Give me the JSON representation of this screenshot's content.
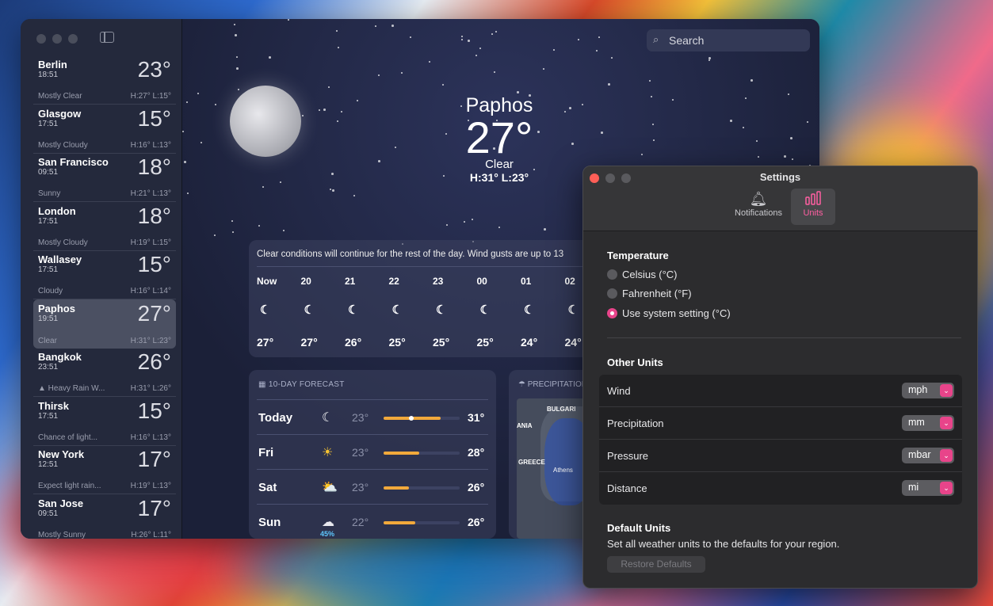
{
  "search": {
    "placeholder": "Search"
  },
  "sidebar": {
    "cities": [
      {
        "name": "Berlin",
        "time": "18:51",
        "temp": "23°",
        "condition": "Mostly Clear",
        "hilo": "H:27° L:15°"
      },
      {
        "name": "Glasgow",
        "time": "17:51",
        "temp": "15°",
        "condition": "Mostly Cloudy",
        "hilo": "H:16° L:13°"
      },
      {
        "name": "San Francisco",
        "time": "09:51",
        "temp": "18°",
        "condition": "Sunny",
        "hilo": "H:21° L:13°"
      },
      {
        "name": "London",
        "time": "17:51",
        "temp": "18°",
        "condition": "Mostly Cloudy",
        "hilo": "H:19° L:15°"
      },
      {
        "name": "Wallasey",
        "time": "17:51",
        "temp": "15°",
        "condition": "Cloudy",
        "hilo": "H:16° L:14°"
      },
      {
        "name": "Paphos",
        "time": "19:51",
        "temp": "27°",
        "condition": "Clear",
        "hilo": "H:31° L:23°"
      },
      {
        "name": "Bangkok",
        "time": "23:51",
        "temp": "26°",
        "condition": "▲ Heavy Rain W...",
        "hilo": "H:31° L:26°"
      },
      {
        "name": "Thirsk",
        "time": "17:51",
        "temp": "15°",
        "condition": "Chance of light...",
        "hilo": "H:16° L:13°"
      },
      {
        "name": "New York",
        "time": "12:51",
        "temp": "17°",
        "condition": "Expect light rain...",
        "hilo": "H:19° L:13°"
      },
      {
        "name": "San Jose",
        "time": "09:51",
        "temp": "17°",
        "condition": "Mostly Sunny",
        "hilo": "H:26° L:11°"
      }
    ]
  },
  "hero": {
    "place": "Paphos",
    "temp": "27°",
    "condition": "Clear",
    "hilo": "H:31°  L:23°"
  },
  "hourly": {
    "summary": "Clear conditions will continue for the rest of the day. Wind gusts are up to 13",
    "hours": [
      {
        "time": "Now",
        "icon": "moon-star-icon",
        "glyph": "☾",
        "temp": "27°"
      },
      {
        "time": "20",
        "icon": "moon-star-icon",
        "glyph": "☾",
        "temp": "27°"
      },
      {
        "time": "21",
        "icon": "moon-star-icon",
        "glyph": "☾",
        "temp": "26°"
      },
      {
        "time": "22",
        "icon": "moon-star-icon",
        "glyph": "☾",
        "temp": "25°"
      },
      {
        "time": "23",
        "icon": "moon-star-icon",
        "glyph": "☾",
        "temp": "25°"
      },
      {
        "time": "00",
        "icon": "moon-star-icon",
        "glyph": "☾",
        "temp": "25°"
      },
      {
        "time": "01",
        "icon": "moon-star-icon",
        "glyph": "☾",
        "temp": "24°"
      },
      {
        "time": "02",
        "icon": "moon-star-icon",
        "glyph": "☾",
        "temp": "24°"
      }
    ]
  },
  "tenday": {
    "header": "10-DAY FORECAST",
    "days": [
      {
        "day": "Today",
        "icon": "moon-star-icon",
        "glyph": "☾",
        "low": "23°",
        "high": "31°"
      },
      {
        "day": "Fri",
        "icon": "sun-icon",
        "glyph": "☀",
        "low": "23°",
        "high": "28°"
      },
      {
        "day": "Sat",
        "icon": "partly-cloudy-icon",
        "glyph": "⛅",
        "low": "23°",
        "high": "26°"
      },
      {
        "day": "Sun",
        "icon": "rain-cloud-icon",
        "glyph": "☁",
        "precip": "45%",
        "low": "22°",
        "high": "26°"
      }
    ]
  },
  "precip": {
    "header": "PRECIPITATION",
    "labels": {
      "bulgaria": "BULGARI",
      "ania": "ANIA",
      "greece": "GREECE",
      "athens": "Athens"
    }
  },
  "settings": {
    "title": "Settings",
    "tabs": {
      "notifications": "Notifications",
      "units": "Units"
    },
    "temperature": {
      "heading": "Temperature",
      "options": [
        "Celsius (°C)",
        "Fahrenheit (°F)",
        "Use system setting (°C)"
      ],
      "selected": "Use system setting (°C)"
    },
    "other_units": {
      "heading": "Other Units",
      "rows": [
        {
          "label": "Wind",
          "value": "mph"
        },
        {
          "label": "Precipitation",
          "value": "mm"
        },
        {
          "label": "Pressure",
          "value": "mbar"
        },
        {
          "label": "Distance",
          "value": "mi"
        }
      ]
    },
    "defaults": {
      "heading": "Default Units",
      "description": "Set all weather units to the defaults for your region.",
      "button": "Restore Defaults"
    },
    "accent_color": "#e8448a"
  }
}
